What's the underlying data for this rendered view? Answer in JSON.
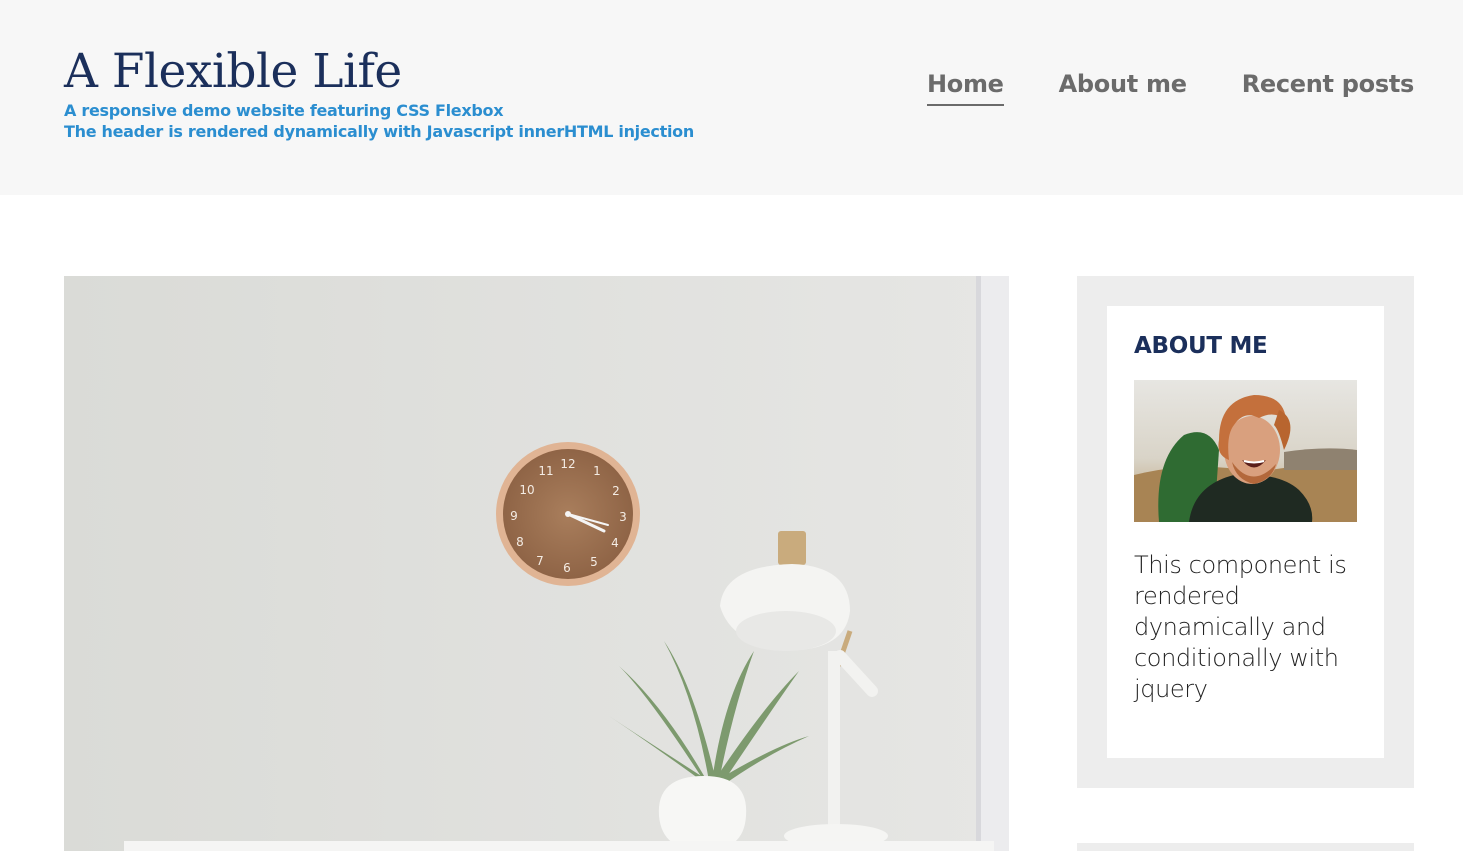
{
  "header": {
    "title": "A Flexible Life",
    "tagline_1": "A responsive demo website featuring CSS Flexbox",
    "tagline_2": "The header is rendered dynamically with Javascript innerHTML injection",
    "nav": [
      {
        "label": "Home",
        "active": true
      },
      {
        "label": "About me",
        "active": false
      },
      {
        "label": "Recent posts",
        "active": false
      }
    ]
  },
  "sidebar": {
    "about_title": "ABOUT ME",
    "about_text": "This component is rendered dynamically and conditionally with jquery"
  },
  "colors": {
    "title": "#1b2f5b",
    "tagline": "#2b8ed0",
    "nav": "#6b6b6b",
    "header_bg": "#f7f7f7",
    "sidebar_bg": "#ededed"
  }
}
